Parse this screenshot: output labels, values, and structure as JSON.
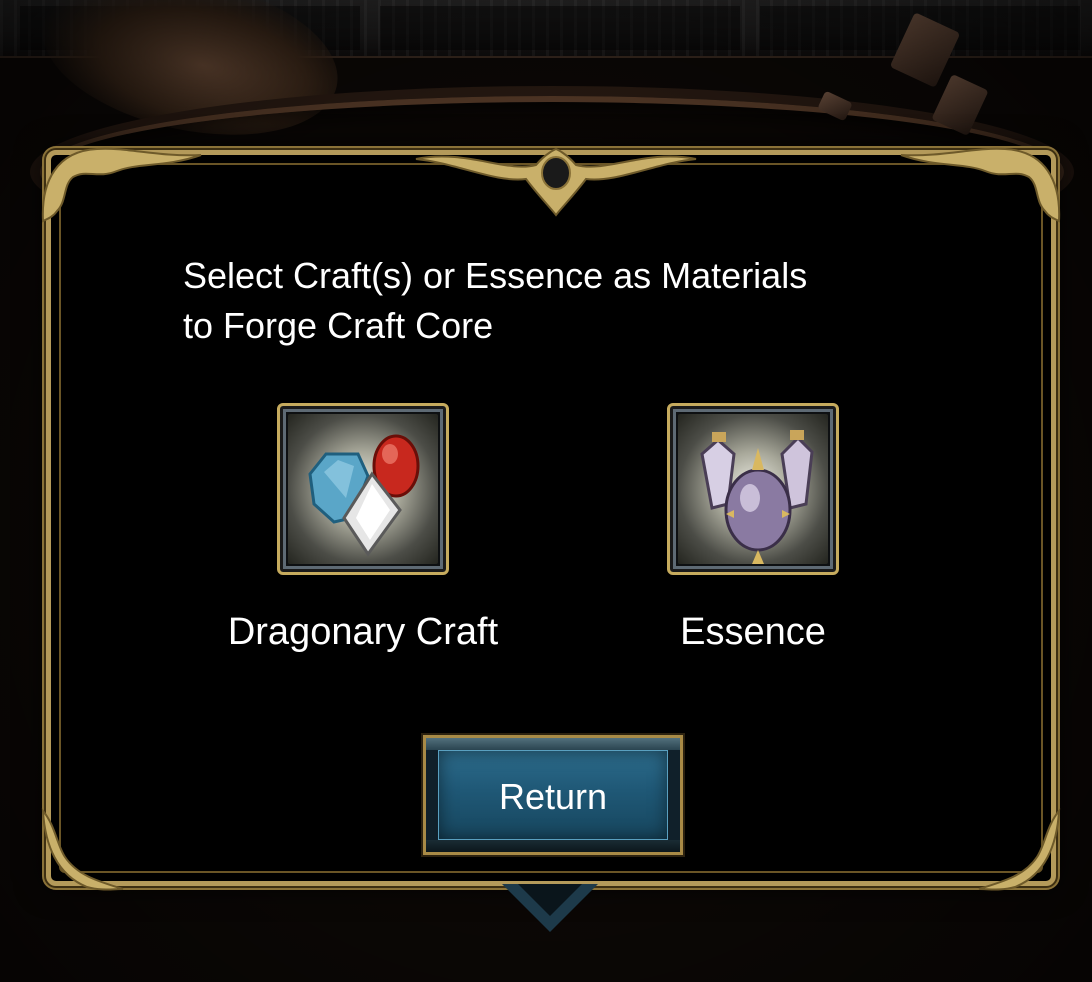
{
  "dialog": {
    "title": "Select Craft(s) or Essence as Materials\nto Forge Craft Core"
  },
  "options": [
    {
      "label": "Dragonary Craft",
      "icon": "gems-icon"
    },
    {
      "label": "Essence",
      "icon": "essence-vials-icon"
    }
  ],
  "buttons": {
    "return_label": "Return"
  },
  "colors": {
    "frame_gold": "#b49a5a",
    "button_blue": "#1f5876",
    "dialog_bg": "#000000",
    "text": "#ffffff"
  }
}
